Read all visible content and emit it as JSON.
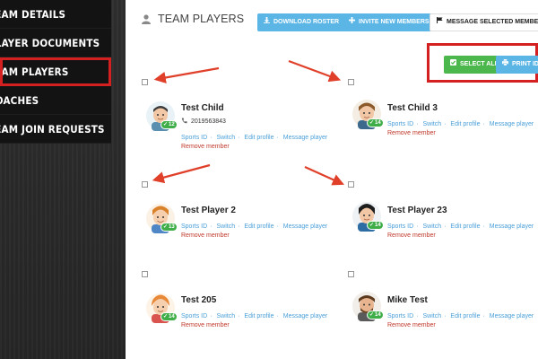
{
  "sidebar": {
    "items": [
      {
        "label": "TEAM DETAILS"
      },
      {
        "label": "PLAYER DOCUMENTS"
      },
      {
        "label": "TEAM PLAYERS"
      },
      {
        "label": "COACHES"
      },
      {
        "label": "TEAM JOIN REQUESTS"
      }
    ]
  },
  "header": {
    "title": "TEAM PLAYERS",
    "download_label": "DOWNLOAD ROSTER",
    "invite_label": "INVITE NEW MEMBERS",
    "message_label": "MESSAGE SELECTED MEMBERS"
  },
  "actions": {
    "select_all_label": "SELECT ALL",
    "print_ids_label": "PRINT IDS"
  },
  "players": [
    {
      "name": "Test Child",
      "badge": "12",
      "phone": "2019563843",
      "links": [
        "Sports ID",
        "Switch",
        "Edit profile",
        "Message player"
      ],
      "remove": "Remove member"
    },
    {
      "name": "Test Child 3",
      "badge": "14",
      "links": [
        "Sports ID",
        "Switch",
        "Edit profile",
        "Message player"
      ],
      "remove": "Remove member"
    },
    {
      "name": "Test Player 2",
      "badge": "13",
      "links": [
        "Sports ID",
        "Switch",
        "Edit profile",
        "Message player"
      ],
      "remove": "Remove member"
    },
    {
      "name": "Test Player 23",
      "badge": "14",
      "links": [
        "Sports ID",
        "Switch",
        "Edit profile",
        "Message player"
      ],
      "remove": "Remove member"
    },
    {
      "name": "Test 205",
      "badge": "14",
      "links": [
        "Sports ID",
        "Switch",
        "Edit profile",
        "Message player"
      ],
      "remove": "Remove member"
    },
    {
      "name": "Mike Test",
      "badge": "14",
      "links": [
        "Sports ID",
        "Switch",
        "Edit profile",
        "Message player"
      ],
      "remove": "Remove member"
    }
  ],
  "colors": {
    "accent_blue": "#5bb6e6",
    "success_green": "#4cb74c",
    "highlight_red": "#d42020",
    "link_blue": "#4a9fd8",
    "remove_red": "#c0392b"
  },
  "icons": {
    "title": "user-icon",
    "download": "download-icon",
    "invite": "plus-icon",
    "message": "flag-icon",
    "select_all": "checkbox-icon",
    "print": "print-icon",
    "phone": "phone-icon"
  }
}
